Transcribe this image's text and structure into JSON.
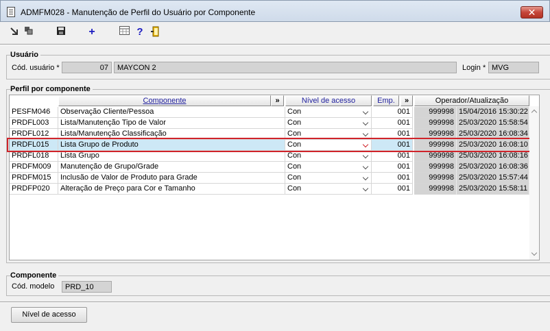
{
  "window": {
    "title": "ADMFM028 - Manutenção de Perfil do Usuário por Componente",
    "close_label": "✕"
  },
  "toolbar": {
    "items": [
      {
        "name": "back-icon",
        "glyph": "↘"
      },
      {
        "name": "copy-icon",
        "glyph": "⧉"
      },
      {
        "name": "save-icon",
        "glyph": "💾"
      },
      {
        "name": "add-icon",
        "glyph": "+"
      },
      {
        "name": "calculator-icon",
        "glyph": "▦"
      },
      {
        "name": "help-icon",
        "glyph": "?"
      },
      {
        "name": "exit-icon",
        "glyph": "⎆"
      }
    ]
  },
  "usuario": {
    "group_title": "Usuário",
    "cod_label": "Cód. usuário *",
    "cod_value": "07",
    "name_value": "MAYCON 2",
    "login_label": "Login *",
    "login_value": "MVG"
  },
  "perfil": {
    "group_title": "Perfil por componente",
    "columns": {
      "componente": "Componente",
      "expand1": "»",
      "nivel": "Nível de acesso",
      "emp": "Emp.",
      "expand2": "»",
      "operador": "Operador/Atualização"
    },
    "rows": [
      {
        "code": "PESFM046",
        "desc": "Observação Cliente/Pessoa",
        "nivel": "Con",
        "emp": "001",
        "oper": "999998",
        "data": "15/04/2016 15:30:22"
      },
      {
        "code": "PRDFL003",
        "desc": "Lista/Manutenção Tipo de Valor",
        "nivel": "Con",
        "emp": "001",
        "oper": "999998",
        "data": "25/03/2020 15:58:54"
      },
      {
        "code": "PRDFL012",
        "desc": "Lista/Manutenção Classificação",
        "nivel": "Con",
        "emp": "001",
        "oper": "999998",
        "data": "25/03/2020 16:08:34"
      },
      {
        "code": "PRDFL015",
        "desc": "Lista Grupo de Produto",
        "nivel": "Con",
        "emp": "001",
        "oper": "999998",
        "data": "25/03/2020 16:08:10"
      },
      {
        "code": "PRDFL018",
        "desc": "Lista Grupo",
        "nivel": "Con",
        "emp": "001",
        "oper": "999998",
        "data": "25/03/2020 16:08:16"
      },
      {
        "code": "PRDFM009",
        "desc": "Manutenção de Grupo/Grade",
        "nivel": "Con",
        "emp": "001",
        "oper": "999998",
        "data": "25/03/2020 16:08:36"
      },
      {
        "code": "PRDFM015",
        "desc": "Inclusão de Valor de Produto para Grade",
        "nivel": "Con",
        "emp": "001",
        "oper": "999998",
        "data": "25/03/2020 15:57:44"
      },
      {
        "code": "PRDFP020",
        "desc": "Alteração de Preço para Cor e Tamanho",
        "nivel": "Con",
        "emp": "001",
        "oper": "999998",
        "data": "25/03/2020 15:58:11"
      }
    ]
  },
  "componente": {
    "group_title": "Componente",
    "cod_modelo_label": "Cód. modelo",
    "cod_modelo_value": "PRD_10"
  },
  "buttons": {
    "nivel_acesso": "Nível de acesso"
  },
  "colors": {
    "selection_outline": "#d0232a",
    "selection_fill": "#cde8f6",
    "header_text": "#1d1d9c"
  }
}
